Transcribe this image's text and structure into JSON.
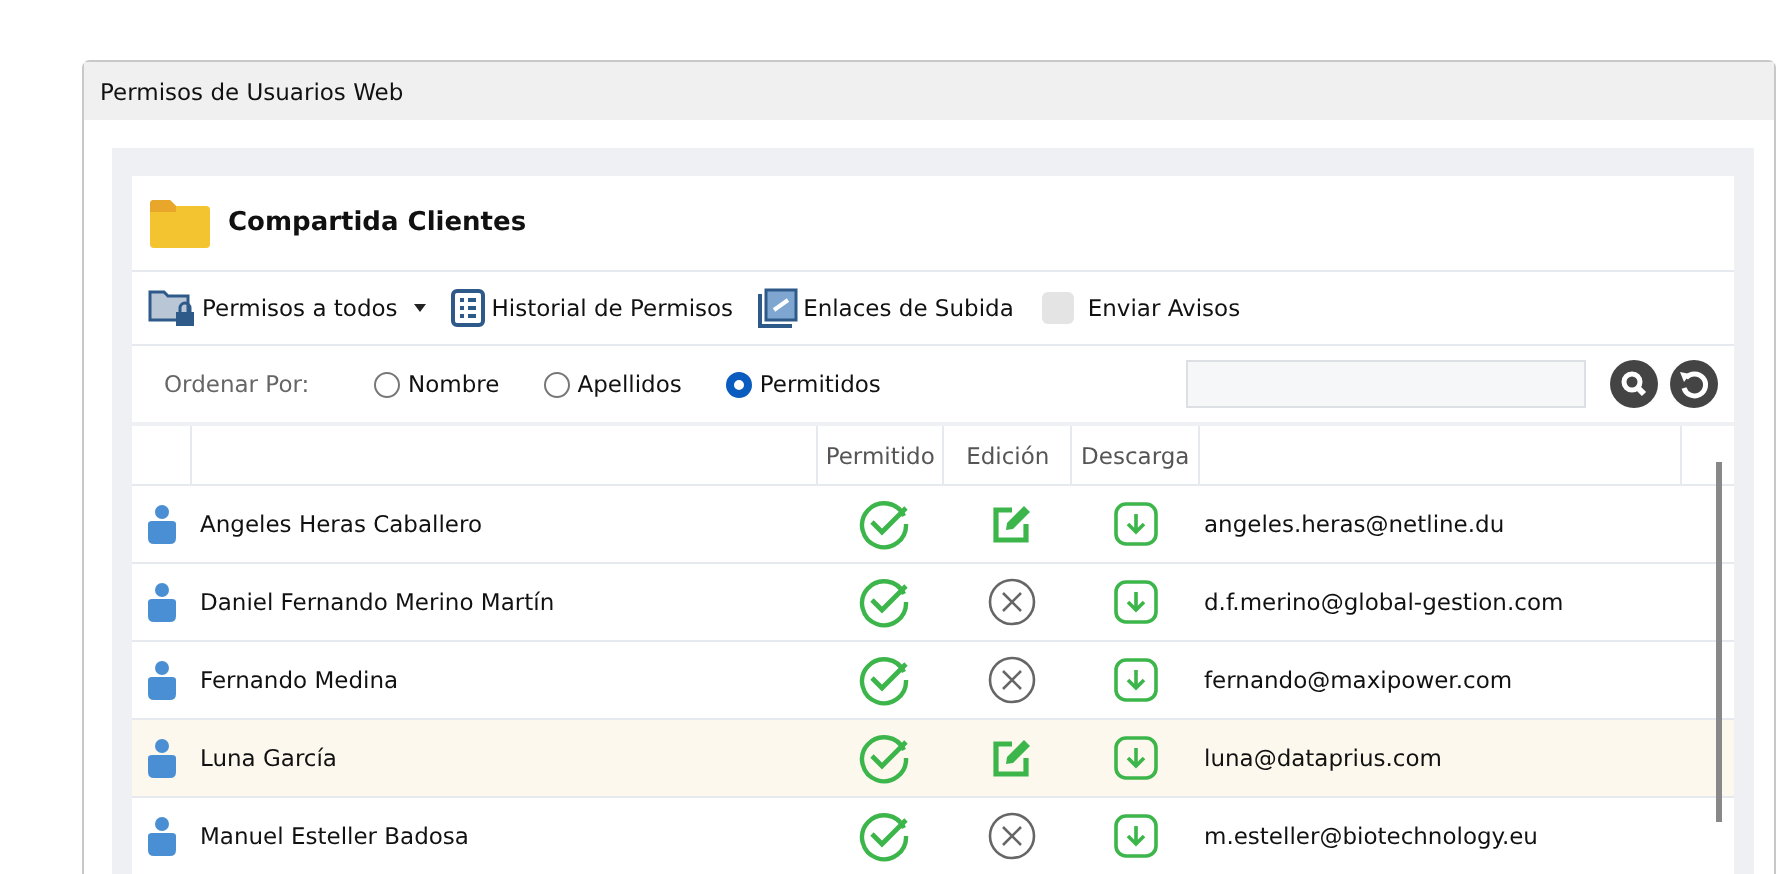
{
  "window": {
    "title": "Permisos de Usuarios Web"
  },
  "folder": {
    "name": "Compartida Clientes"
  },
  "toolbar": [
    {
      "kind": "dropdown",
      "label": "Permisos a todos"
    },
    {
      "kind": "history",
      "label": "Historial de Permisos"
    },
    {
      "kind": "links",
      "label": "Enlaces de Subida"
    },
    {
      "kind": "checkbox",
      "label": "Enviar Avisos",
      "checked": false
    }
  ],
  "sort": {
    "label": "Ordenar Por:",
    "options": [
      {
        "label": "Nombre",
        "selected": false
      },
      {
        "label": "Apellidos",
        "selected": false
      },
      {
        "label": "Permitidos",
        "selected": true
      }
    ]
  },
  "table": {
    "columns": [
      "Permitido",
      "Edición",
      "Descarga"
    ],
    "rows": [
      {
        "name": "Angeles Heras Caballero",
        "permitido": true,
        "edicion": true,
        "descarga": true,
        "email": "angeles.heras@netline.du",
        "selected": false
      },
      {
        "name": "Daniel Fernando Merino Martín",
        "permitido": true,
        "edicion": false,
        "descarga": true,
        "email": "d.f.merino@global-gestion.com",
        "selected": false
      },
      {
        "name": "Fernando Medina",
        "permitido": true,
        "edicion": false,
        "descarga": true,
        "email": "fernando@maxipower.com",
        "selected": false
      },
      {
        "name": "Luna García",
        "permitido": true,
        "edicion": true,
        "descarga": true,
        "email": "luna@dataprius.com",
        "selected": true
      },
      {
        "name": "Manuel Esteller Badosa",
        "permitido": true,
        "edicion": false,
        "descarga": true,
        "email": "m.esteller@biotechnology.eu",
        "selected": false
      }
    ]
  }
}
